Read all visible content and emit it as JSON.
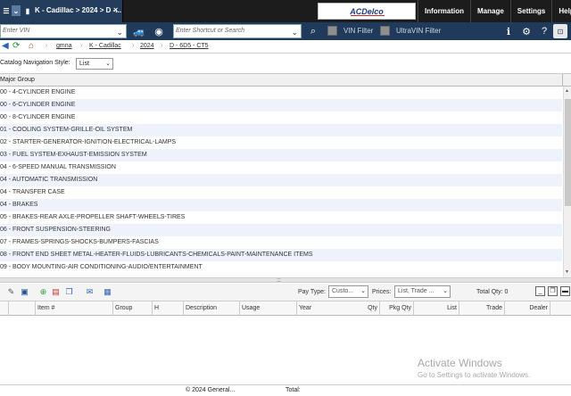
{
  "top_tab": {
    "title": "K - Cadillac > 2024 > D -...",
    "close": "×"
  },
  "brand": {
    "logo": "ACDelco"
  },
  "top_nav": [
    "Information",
    "Manage",
    "Settings",
    "Help"
  ],
  "vin": {
    "placeholder": "Enter VIN"
  },
  "shortcut": {
    "placeholder": "Enter Shortcut or Search"
  },
  "filters": {
    "vin": "VIN Filter",
    "ultravin": "UltraVIN Filter"
  },
  "breadcrumb": [
    "gmna",
    "K - Cadillac",
    "2024",
    "D - 6D5 - CT5"
  ],
  "catalog_style": {
    "label": "Catalog Navigation Style:",
    "value": "List"
  },
  "grid": {
    "header": "Major Group",
    "rows": [
      "00 - 4-CYLINDER ENGINE",
      "00 - 6-CYLINDER ENGINE",
      "00 - 8-CYLINDER ENGINE",
      "01 - COOLING SYSTEM-GRILLE-OIL SYSTEM",
      "02 - STARTER-GENERATOR-IGNITION-ELECTRICAL-LAMPS",
      "03 - FUEL SYSTEM-EXHAUST-EMISSION SYSTEM",
      "04 - 6-SPEED MANUAL TRANSMISSION",
      "04 - AUTOMATIC TRANSMISSION",
      "04 - TRANSFER CASE",
      "04 - BRAKES",
      "05 - BRAKES-REAR AXLE-PROPELLER SHAFT-WHEELS-TIRES",
      "06 - FRONT SUSPENSION-STEERING",
      "07 - FRAMES-SPRINGS-SHOCKS-BUMPERS-FASCIAS",
      "08 - FRONT END SHEET METAL-HEATER-FLUIDS-LUBRICANTS-CHEMICALS-PAINT-MAINTENANCE ITEMS",
      "09 - BODY MOUNTING-AIR CONDITIONING-AUDIO/ENTERTAINMENT"
    ]
  },
  "parts_toolbar": {
    "pay_type_label": "Pay Type:",
    "pay_type_value": "Custo...",
    "prices_label": "Prices:",
    "prices_value": "List, Trade ...",
    "total_qty": "Total Qty: 0"
  },
  "parts_columns": [
    "Item #",
    "Group",
    "H",
    "Description",
    "Usage",
    "Year",
    "Qty",
    "Pkg Qty",
    "List",
    "Trade",
    "Dealer"
  ],
  "watermark": {
    "title": "Activate Windows",
    "sub": "Go to Settings to activate Windows."
  },
  "status": {
    "copyright": "© 2024 General...",
    "total": "Total:"
  },
  "colors": {
    "topbar": "#1c1c1c",
    "toolbar": "#1f3a5b",
    "tab": "#243d5c",
    "row_alt": "#eef3fb"
  }
}
